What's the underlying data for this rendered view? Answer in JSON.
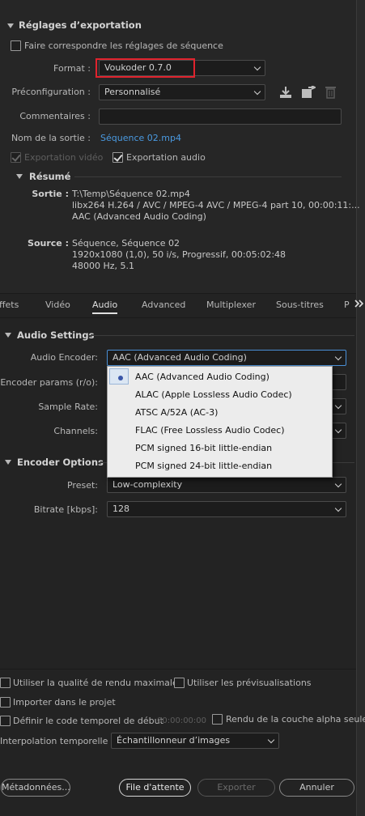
{
  "export_settings": {
    "header": "Réglages d’exportation",
    "match_sequence_label": "Faire correspondre les réglages de séquence",
    "format_label": "Format :",
    "format_value": "Voukoder 0.7.0",
    "preset_label": "Préconfiguration :",
    "preset_value": "Personnalisé",
    "comments_label": "Commentaires :",
    "comments_value": "",
    "output_name_label": "Nom de la sortie :",
    "output_name_value": "Séquence 02.mp4",
    "export_video_label": "Exportation vidéo",
    "export_video_checked": true,
    "export_audio_label": "Exportation audio",
    "export_audio_checked": true
  },
  "summary": {
    "header": "Résumé",
    "output_label": "Sortie :",
    "output_lines": [
      "T:\\Temp\\Séquence 02.mp4",
      "libx264 H.264 / AVC / MPEG-4 AVC / MPEG-4 part 10, 00:00:11:...",
      "AAC (Advanced Audio Coding)"
    ],
    "source_label": "Source :",
    "source_lines": [
      "Séquence, Séquence 02",
      "1920x1080 (1,0), 50  i/s, Progressif, 00:05:02:48",
      "48000 Hz, 5.1"
    ]
  },
  "tabs": [
    "Effets",
    "Vidéo",
    "Audio",
    "Advanced",
    "Multiplexer",
    "Sous-titres",
    "P"
  ],
  "tabs_more_icon": "double-chevron-right-icon",
  "audio_settings": {
    "header": "Audio Settings",
    "encoder_label": "Audio Encoder:",
    "encoder_value": "AAC (Advanced Audio Coding)",
    "encoder_params_label": "Encoder params (r/o):",
    "sample_rate_label": "Sample Rate:",
    "channels_label": "Channels:",
    "encoder_options": [
      "AAC (Advanced Audio Coding)",
      "ALAC (Apple Lossless Audio Codec)",
      "ATSC A/52A (AC-3)",
      "FLAC (Free Lossless Audio Codec)",
      "PCM signed 16-bit little-endian",
      "PCM signed 24-bit little-endian"
    ]
  },
  "encoder_options": {
    "header": "Encoder Options",
    "preset_label": "Preset:",
    "preset_value": "Low-complexity",
    "bitrate_label": "Bitrate [kbps]:",
    "bitrate_value": "128"
  },
  "bottom": {
    "max_render_quality": "Utiliser la qualité de rendu maximale",
    "use_previews": "Utiliser les prévisualisations",
    "import_into_project": "Importer dans le projet",
    "set_start_timecode": "Définir le code temporel de début",
    "timecode_value": "00:00:00:00",
    "render_alpha_only": "Rendu de la couche alpha seule",
    "time_interpolation_label": "Interpolation temporelle :",
    "time_interpolation_value": "Échantillonneur d’images",
    "metadata_button": "Métadonnées...",
    "queue_button": "File d'attente",
    "export_button": "Exporter",
    "cancel_button": "Annuler"
  },
  "colors": {
    "accent_link": "#4a9ae1",
    "highlight_box": "#e0232d",
    "focus_border": "#4a8fd6"
  }
}
